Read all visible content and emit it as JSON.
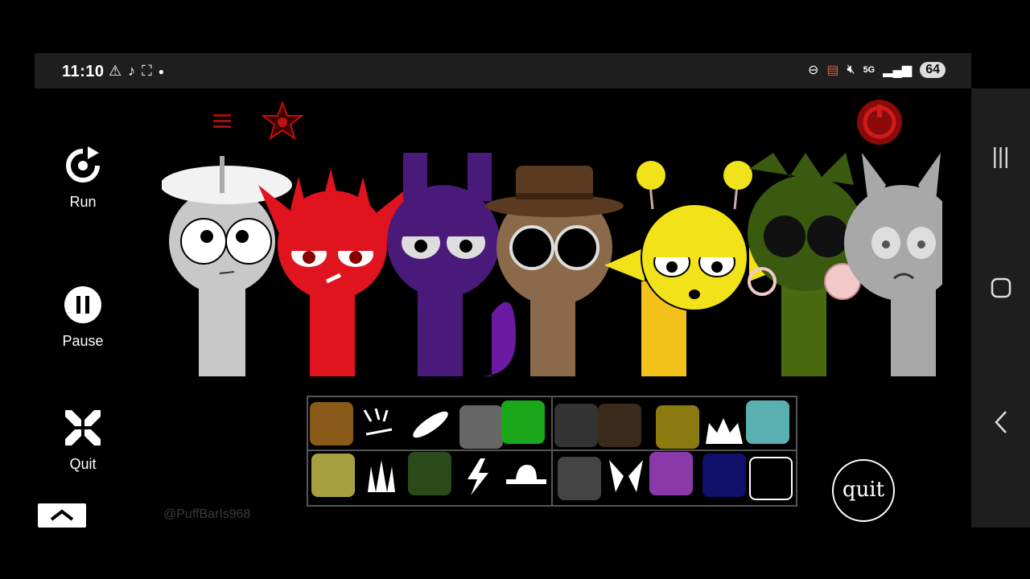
{
  "status_bar": {
    "time": "11:10",
    "battery": "64",
    "network": "5G"
  },
  "controls": {
    "run_label": "Run",
    "pause_label": "Pause",
    "quit_label": "Quit"
  },
  "quit_button_label": "quit",
  "watermark": "@PuffBarIs968",
  "colors": {
    "accent_red": "#d01a1a",
    "character_grey": "#c8c8c8",
    "character_red": "#e0141e",
    "character_purple": "#4a1a7a",
    "character_brown": "#8a6a4a",
    "character_yellow": "#f2e21a",
    "character_green": "#4a6a10",
    "character_silver": "#a8a8a8"
  },
  "icons": {
    "menu": "hamburger-icon",
    "star": "star-icon",
    "restart": "power-icon",
    "run": "reload-icon",
    "pause": "pause-icon",
    "quit": "shrink-icon",
    "collapse": "chevron-up-icon"
  }
}
